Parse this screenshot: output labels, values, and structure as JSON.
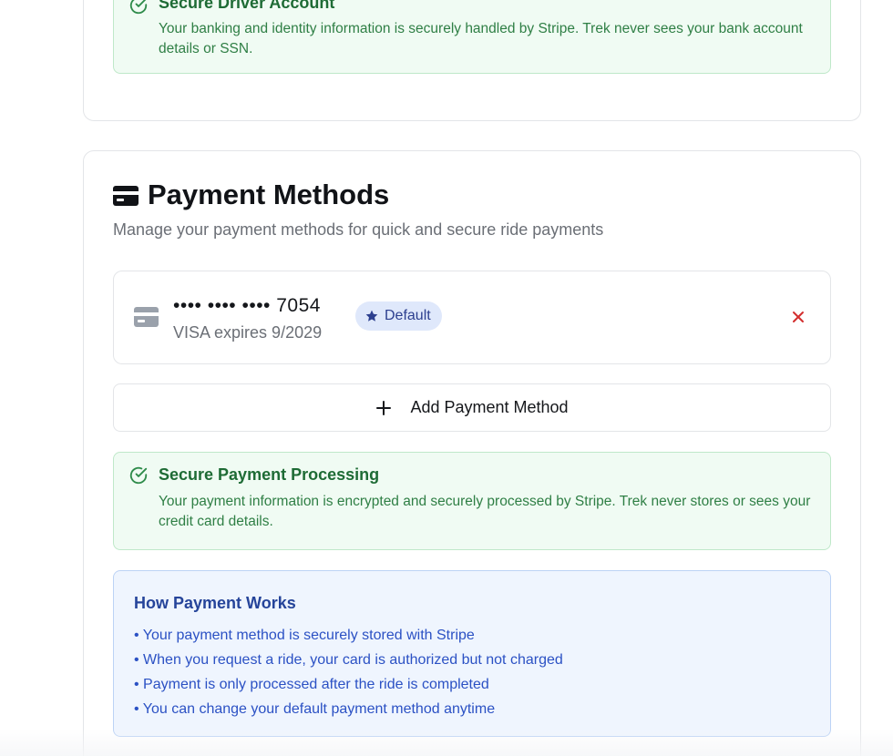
{
  "driver_notice": {
    "title": "Secure Driver Account",
    "body": "Your banking and identity information is securely handled by Stripe. Trek never sees your bank account details or SSN.",
    "icon": "check-circle-icon"
  },
  "payment_methods": {
    "title": "Payment Methods",
    "subtitle": "Manage your payment methods for quick and secure ride payments",
    "header_icon": "credit-card-icon",
    "cards": [
      {
        "number": "•••• •••• •••• 7054",
        "expiry": "VISA expires 9/2029",
        "badge": "Default",
        "badge_icon": "star-icon",
        "remove_icon": "close-icon"
      }
    ],
    "add_button_label": "Add Payment Method"
  },
  "payment_notice": {
    "title": "Secure Payment Processing",
    "body": "Your payment information is encrypted and securely processed by Stripe. Trek never stores or sees your credit card details.",
    "icon": "check-circle-icon"
  },
  "how_it_works": {
    "title": "How Payment Works",
    "items": [
      "• Your payment method is securely stored with Stripe",
      "• When you request a ride, your card is authorized but not charged",
      "• Payment is only processed after the ride is completed",
      "• You can change your default payment method anytime"
    ]
  },
  "colors": {
    "success_bg": "#f0fbf3",
    "success_text": "#1e6b35",
    "info_bg": "#eff5fe",
    "info_text": "#2b51c4",
    "badge_bg": "#dfe8fb",
    "danger": "#d32f2f"
  }
}
